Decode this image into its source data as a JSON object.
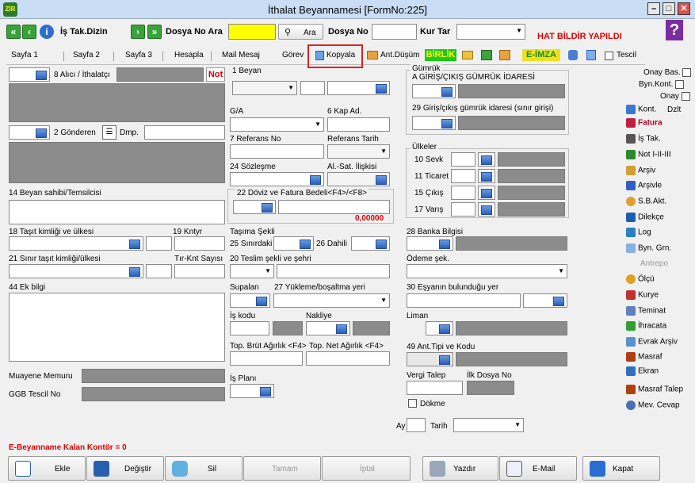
{
  "window": {
    "title": "İthalat Beyannamesi [FormNo:225]",
    "app_icon": "ZİR"
  },
  "toolbar": {
    "is_tak_dizin": "İş Tak.Dizin",
    "dosya_no_ara": "Dosya No Ara",
    "ara_button": "Ara",
    "dosya_no": "Dosya No",
    "kur_tar": "Kur Tar",
    "hat_bildir": "HAT BİLDİR YAPILDI",
    "help": "?"
  },
  "tabs": [
    "Sayfa 1",
    "Sayfa 2",
    "Sayfa 3",
    "Hesapla",
    "Mail Mesaj",
    "Görev",
    "Kopyala",
    "Ant.Düşüm",
    "BİRLİK",
    "E-İMZA",
    "Tescil"
  ],
  "left": {
    "alici": "8 Alıcı / İthalatçı",
    "not": "Not",
    "gonderen": "2 Gönderen",
    "dmp": "Dmp.",
    "beyan_sahibi": "14 Beyan sahibi/Temsilcisi",
    "tasit_kimligi": "18 Taşıt kimliği ve ülkesi",
    "kntyr": "19 Kntyr",
    "sinir_tasit": "21 Sınır taşıt kimliği/ülkesi",
    "trk_sayisi": "Tır-Knt Sayısı",
    "ek_bilgi": "44 Ek bilgi",
    "muayene": "Muayene Memuru",
    "ggb": "GGB Tescil No",
    "kontor": "E-Beyanname Kalan Kontör = 0"
  },
  "middle": {
    "beyan": "1 Beyan",
    "ga": "G/A",
    "kap_ad": "6 Kap Ad.",
    "referans_no": "7 Referans No",
    "referans_tarih": "Referans Tarih",
    "sozlesme": "24 Sözleşme",
    "al_sat": "Al.-Sat. İlişkisi",
    "doviz": "22 Döviz ve Fatura Bedeli<F4>/<F8>",
    "doviz_value": "0,00000",
    "tasima_sekli": "Taşıma Şekli",
    "sinirdaki": "25 Sınırdaki",
    "dahili": "26 Dahili",
    "teslim": "20 Teslim şekli ve şehri",
    "supalan": "Supalan",
    "yukleme": "27 Yükleme/boşaltma yeri",
    "is_kodu": "İş kodu",
    "nakliye": "Nakliye",
    "brut": "Top. Brüt Ağırlık <F4>",
    "net": "Top. Net Ağırlık <F4>",
    "is_plani": "İş Planı"
  },
  "right": {
    "gumruk": "Gümrük",
    "giris_idaresi": "A GİRİŞ/ÇIKIŞ GÜMRÜK İDARESİ",
    "giris_sinir": "29 Giriş/çıkış gümrük idaresi (sınır girişi)",
    "ulkeler": "Ülkeler",
    "sevk": "10 Sevk",
    "ticaret": "11 Ticaret",
    "cikis": "15 Çıkış",
    "varis": "17 Varış",
    "banka": "28 Banka Bilgisi",
    "odeme": "Ödeme şek.",
    "esya_yer": "30 Eşyanın bulunduğu yer",
    "liman": "Liman",
    "ant_tipi": "49 Ant.Tipi ve Kodu",
    "vergi_talep": "Vergi Talep",
    "ilk_dosya": "İlk Dosya No",
    "dokme": "Dökme",
    "ay": "Ay",
    "tarih": "Tarih"
  },
  "side_menu": {
    "onay_bas": "Onay Bas.",
    "byn_kont": "Byn.Kont.",
    "onay": "Onay",
    "kont": "Kont.",
    "dzlt": "Dzlt",
    "fatura": "Fatura",
    "is_tak": "İş Tak.",
    "not_123": "Not I-II-III",
    "arsiv": "Arşiv",
    "arsivle": "Arşivle",
    "sbakt": "S.B.Akt.",
    "dilekce": "Dilekçe",
    "log": "Log",
    "byn_grn": "Byn. Grn.",
    "antrepo": "Antrepo",
    "olcu": "Ölçü",
    "kurye": "Kurye",
    "teminat": "Teminat",
    "ihracata": "İhracata",
    "evrak_arsiv": "Evrak Arşiv",
    "masraf": "Masraf",
    "ekran": "Ekran",
    "masraf_talep": "Masraf Talep",
    "mev_cevap": "Mev. Cevap"
  },
  "bottom": {
    "ekle": "Ekle",
    "degistir": "Değiştir",
    "sil": "Sil",
    "tamam": "Tamam",
    "iptal": "İptal",
    "yazdir": "Yazdır",
    "email": "E-Mail",
    "kapat": "Kapat"
  }
}
